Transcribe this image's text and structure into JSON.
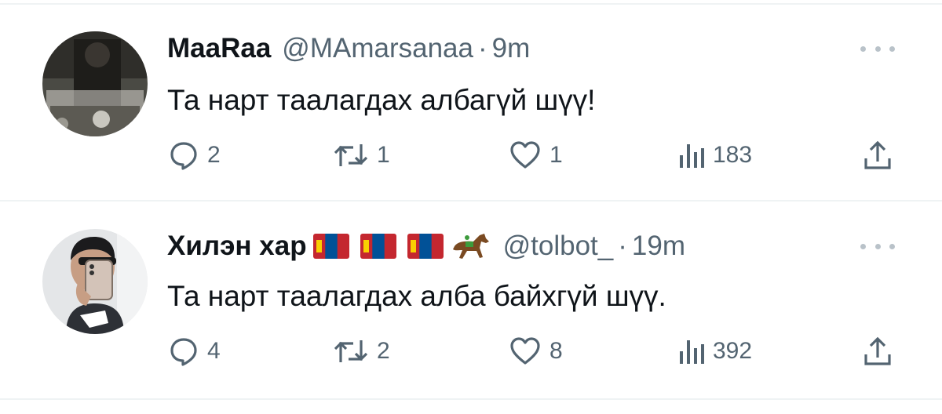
{
  "tweets": [
    {
      "display_name": "MaaRaa",
      "handle": "@MAmarsanaa",
      "separator": "·",
      "time": "9m",
      "text": "Та нарт таалагдах албагүй шүү!",
      "replies": "2",
      "retweets": "1",
      "likes": "1",
      "views": "183",
      "emojis": []
    },
    {
      "display_name": "Хилэн хар",
      "handle": "@tolbot_",
      "separator": "·",
      "time": "19m",
      "text": "Та нарт таалагдах алба байхгүй шүү.",
      "replies": "4",
      "retweets": "2",
      "likes": "8",
      "views": "392",
      "emojis": [
        "mongolia-flag",
        "mongolia-flag",
        "mongolia-flag",
        "horse"
      ]
    }
  ],
  "colors": {
    "text": "#0f1419",
    "secondary": "#536471",
    "divider": "#eff3f4",
    "flag_red": "#c4272f",
    "flag_blue": "#015197",
    "flag_gold": "#f9cf02"
  },
  "icons": [
    "reply-icon",
    "retweet-icon",
    "like-icon",
    "views-icon",
    "share-icon",
    "more-icon"
  ]
}
